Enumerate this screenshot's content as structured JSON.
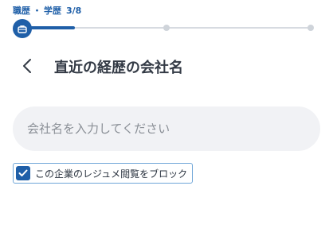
{
  "step": {
    "label": "職歴・学歴",
    "separator": "・",
    "section_a": "職歴",
    "section_b": "学歴",
    "count": "3/8",
    "progress": 0.375
  },
  "header": {
    "back_icon": "chevron-left-icon",
    "title": "直近の経歴の会社名"
  },
  "company_input": {
    "value": "",
    "placeholder": "会社名を入力してください"
  },
  "block_option": {
    "label": "この企業のレジュメ閲覧をブロック",
    "checked": true
  },
  "colors": {
    "accent": "#1f5fa8",
    "input_bg": "#f1f2f5",
    "track": "#d7dbe1"
  }
}
